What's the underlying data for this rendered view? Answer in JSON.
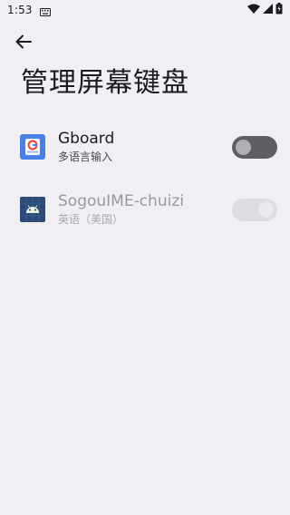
{
  "status_bar": {
    "time": "1:53"
  },
  "page": {
    "title": "管理屏幕键盘"
  },
  "keyboards": [
    {
      "name": "Gboard",
      "languages": "多语言输入",
      "enabled_toggle": false,
      "disabled": false
    },
    {
      "name": "SogouIME-chuizi",
      "languages": "英语（美国）",
      "enabled_toggle": false,
      "disabled": true
    }
  ],
  "icons": {
    "back": "arrow-left-icon",
    "keyboard_notification": "keyboard-icon",
    "wifi": "wifi-icon",
    "signal": "signal-icon",
    "battery": "battery-charging-icon",
    "gboard": "gboard-icon",
    "sogou": "android-icon"
  },
  "colors": {
    "background": "#f1eff4",
    "toggle_off": "#5f5e62",
    "toggle_disabled": "#dedce1"
  }
}
